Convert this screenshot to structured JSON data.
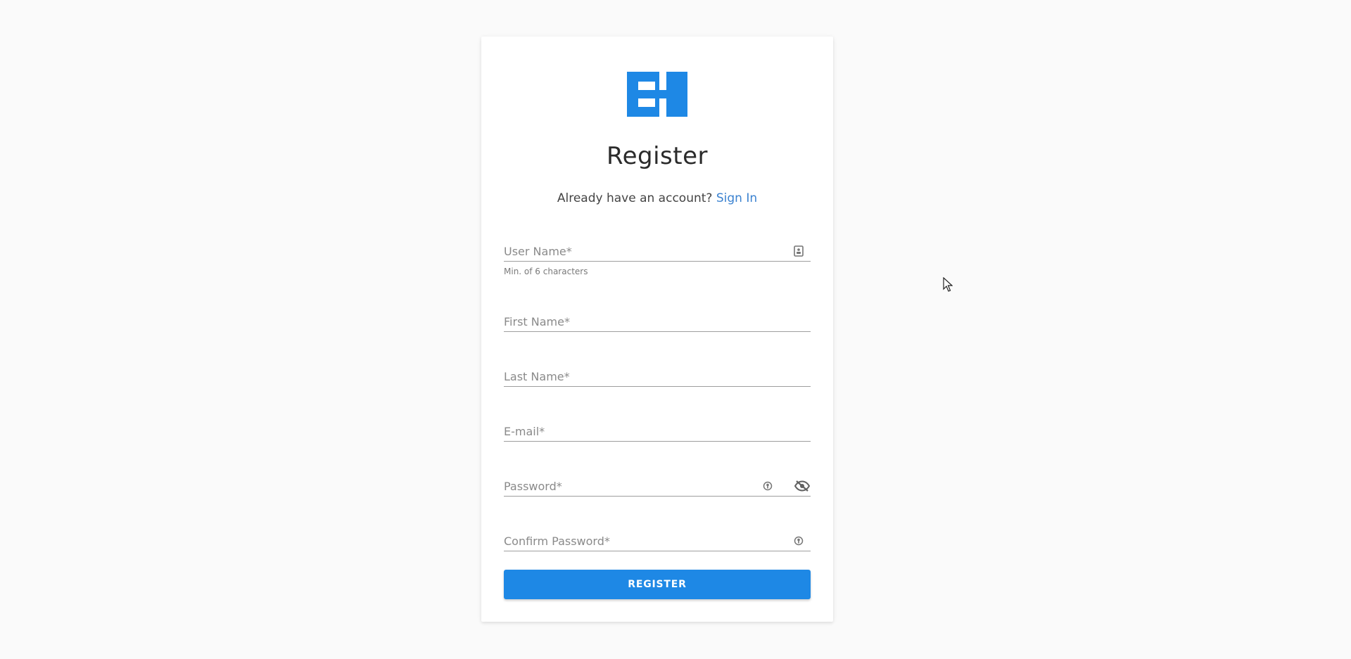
{
  "brand": {
    "accent": "#1e88e5",
    "link_color": "#3b82d0",
    "logo_icon": "eh-logo"
  },
  "title": "Register",
  "signin_prompt": {
    "text": "Already have an account?",
    "link": "Sign In"
  },
  "fields": {
    "username": {
      "placeholder": "User Name*",
      "value": "",
      "hint": "Min. of 6 characters",
      "icon": "contact-card-icon"
    },
    "first_name": {
      "placeholder": "First Name*",
      "value": ""
    },
    "last_name": {
      "placeholder": "Last Name*",
      "value": ""
    },
    "email": {
      "placeholder": "E-mail*",
      "value": ""
    },
    "password": {
      "placeholder": "Password*",
      "value": "",
      "icons": [
        "key-icon",
        "eye-off-icon"
      ]
    },
    "confirm_password": {
      "placeholder": "Confirm Password*",
      "value": "",
      "icon": "key-icon"
    }
  },
  "register_button": "REGISTER"
}
